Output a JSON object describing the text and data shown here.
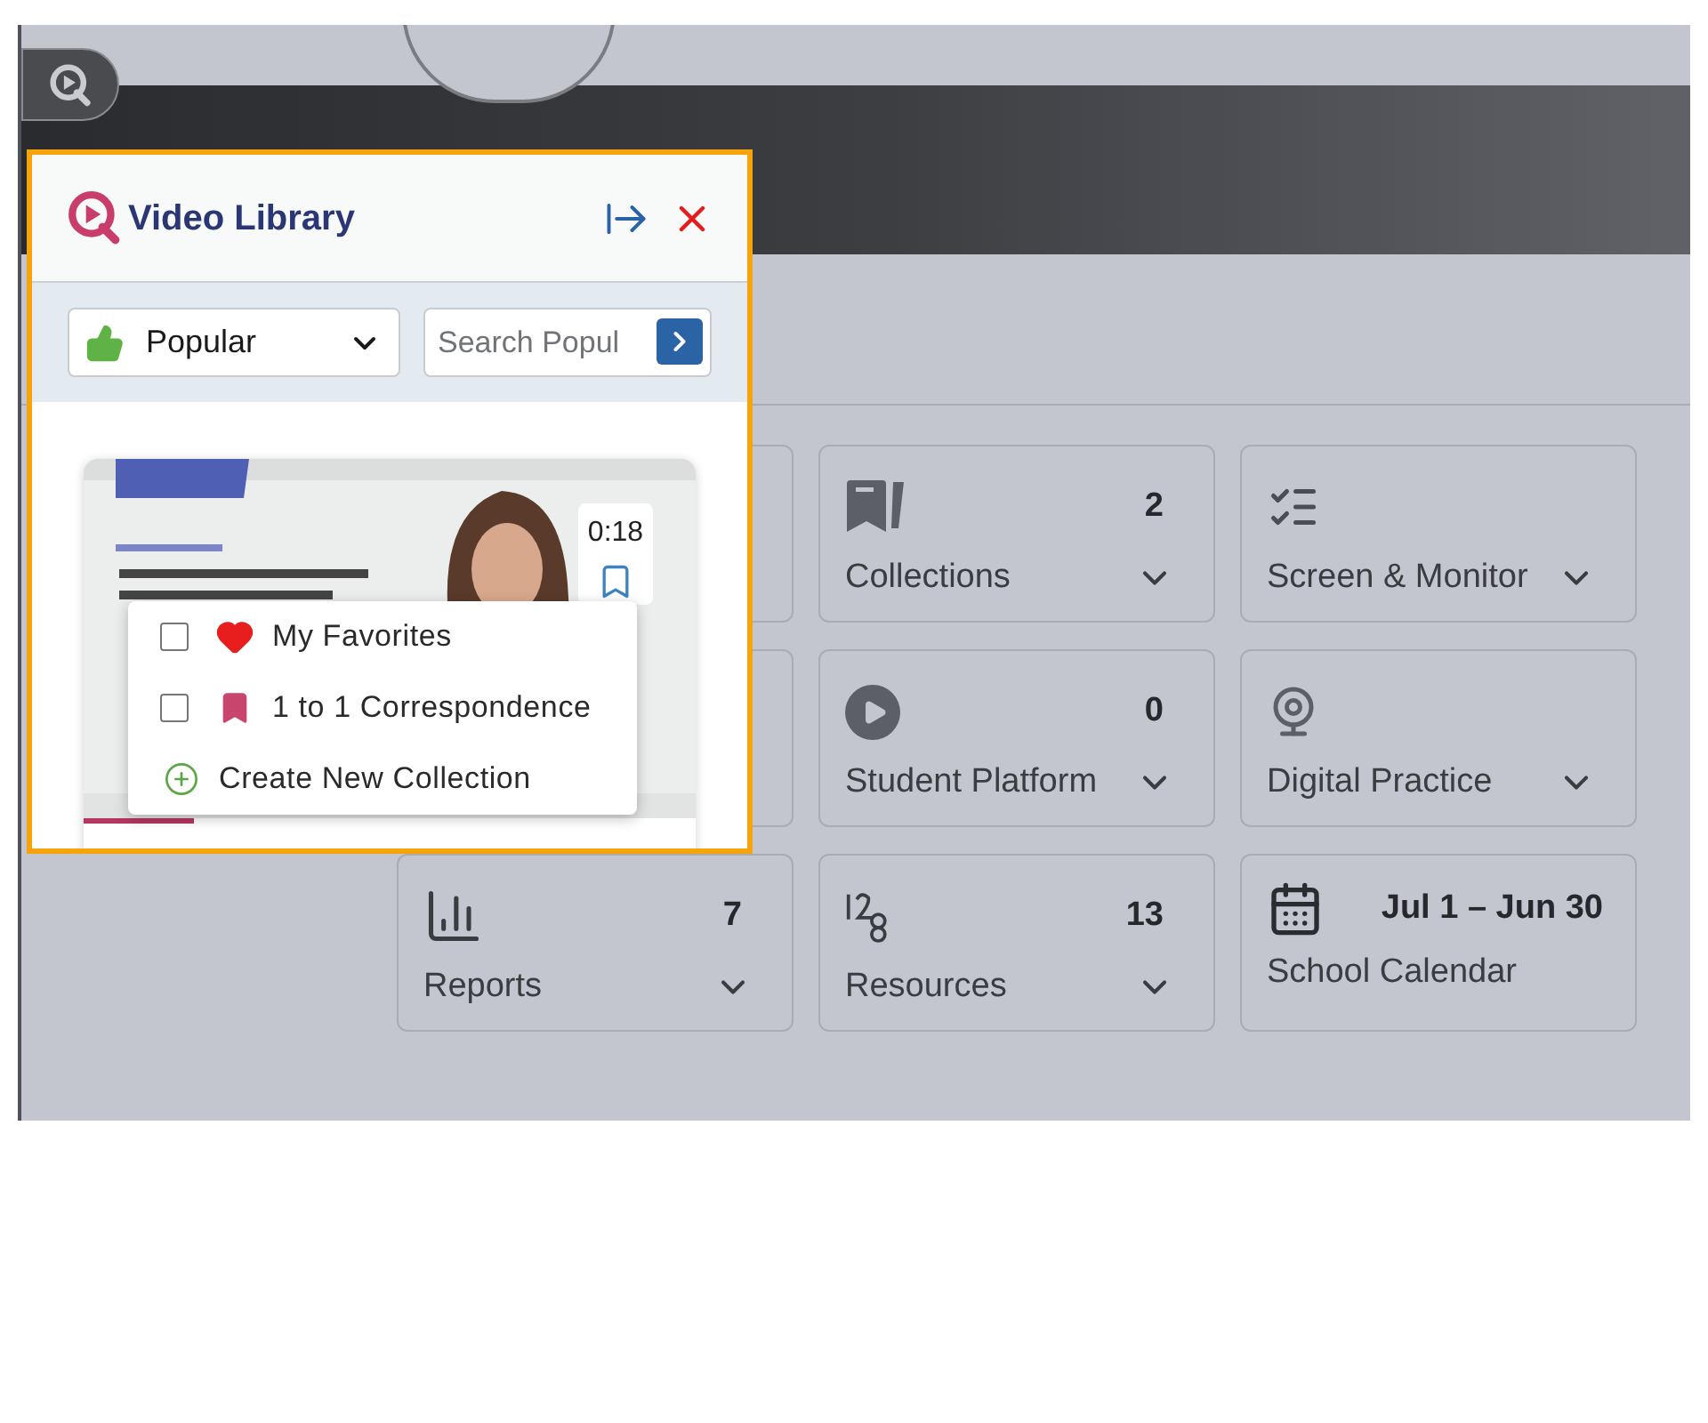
{
  "panel": {
    "title": "Video Library",
    "filter": {
      "value": "Popular"
    },
    "search": {
      "placeholder": "Search Popul"
    },
    "video": {
      "kind": "picture",
      "duration": "0:18",
      "bookmarked": false,
      "level": 0.18,
      "menu": [
        {
          "kind": "favorites",
          "label": "My Favorites",
          "checked": false
        },
        {
          "kind": "collection",
          "label": "1 to 1 Correspondence",
          "checked": false
        },
        {
          "kind": "create",
          "label": "Create New Collection"
        }
      ]
    }
  },
  "cards": [
    {
      "kind": "count",
      "label": "Collections",
      "count": "2"
    },
    {
      "kind": "plain",
      "label": "Screen & Monitor"
    },
    {
      "kind": "count",
      "label": "Student Platform",
      "count": "0"
    },
    {
      "kind": "plain",
      "label": "Digital Practice"
    },
    {
      "kind": "count",
      "label": "Reports",
      "count": "7"
    },
    {
      "kind": "count",
      "label": "Resources",
      "count": "13"
    },
    {
      "kind": "date",
      "label": "School Calendar",
      "count": "Jul 1 – Jun 30"
    }
  ]
}
